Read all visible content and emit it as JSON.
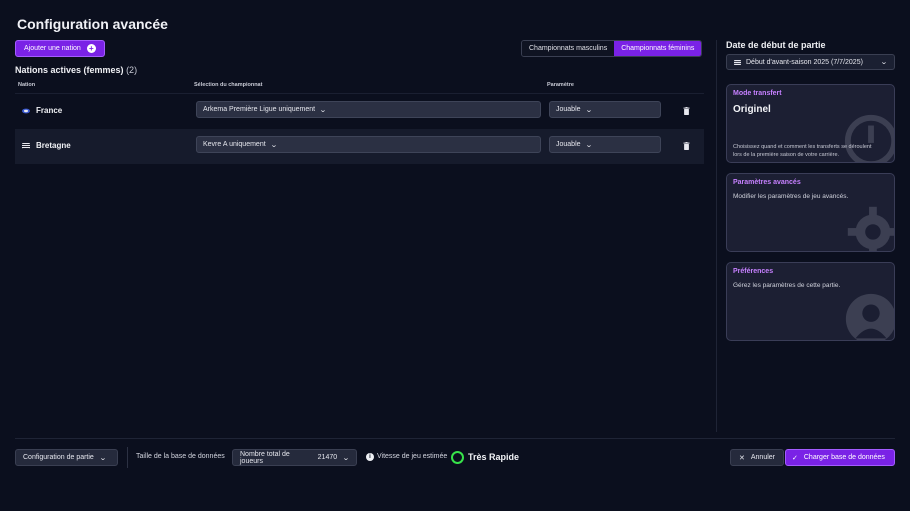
{
  "header": {
    "title": "Configuration avancée",
    "add_nation_label": "Ajouter une nation"
  },
  "tabs": [
    {
      "label": "Championnats masculins",
      "active": false
    },
    {
      "label": "Championnats féminins",
      "active": true
    }
  ],
  "nations": {
    "section_title": "Nations actives (femmes)",
    "count": "(2)",
    "columns": [
      "Nation",
      "Sélection du championnat",
      "Paramètre"
    ],
    "rows": [
      {
        "name": "France",
        "flag_icon": "france-flag-icon",
        "championship": "Arkema Première Ligue uniquement",
        "parameter": "Jouable"
      },
      {
        "name": "Bretagne",
        "flag_icon": "bretagne-flag-icon",
        "championship": "Kevre A uniquement",
        "parameter": "Jouable"
      }
    ]
  },
  "sidebar": {
    "date_title": "Date de début de partie",
    "date_value": "Début d'avant-saison 2025 (7/7/2025)",
    "cards": [
      {
        "title": "Mode transfert",
        "value": "Originel",
        "description": "Choisissez quand et comment les transferts se déroulent lors de la première saison de votre carrière.",
        "icon": "clock-icon"
      },
      {
        "title": "Paramètres avancés",
        "description": "Modifier les paramètres de jeu avancés.",
        "icon": "gear-icon"
      },
      {
        "title": "Préférences",
        "description": "Gérez les paramètres de cette partie.",
        "icon": "user-icon"
      }
    ]
  },
  "footer": {
    "config_label": "Configuration de partie",
    "db_size_label": "Taille de la base de données",
    "players_label": "Nombre total de joueurs",
    "players_value": "21470",
    "speed_label": "Vitesse de jeu estimée",
    "speed_value": "Très Rapide",
    "cancel_label": "Annuler",
    "load_label": "Charger base de données"
  },
  "colors": {
    "accent": "#7a22e6",
    "speed_ok": "#37e24a",
    "card_title": "#c680ff",
    "background": "#0b0f1e"
  }
}
